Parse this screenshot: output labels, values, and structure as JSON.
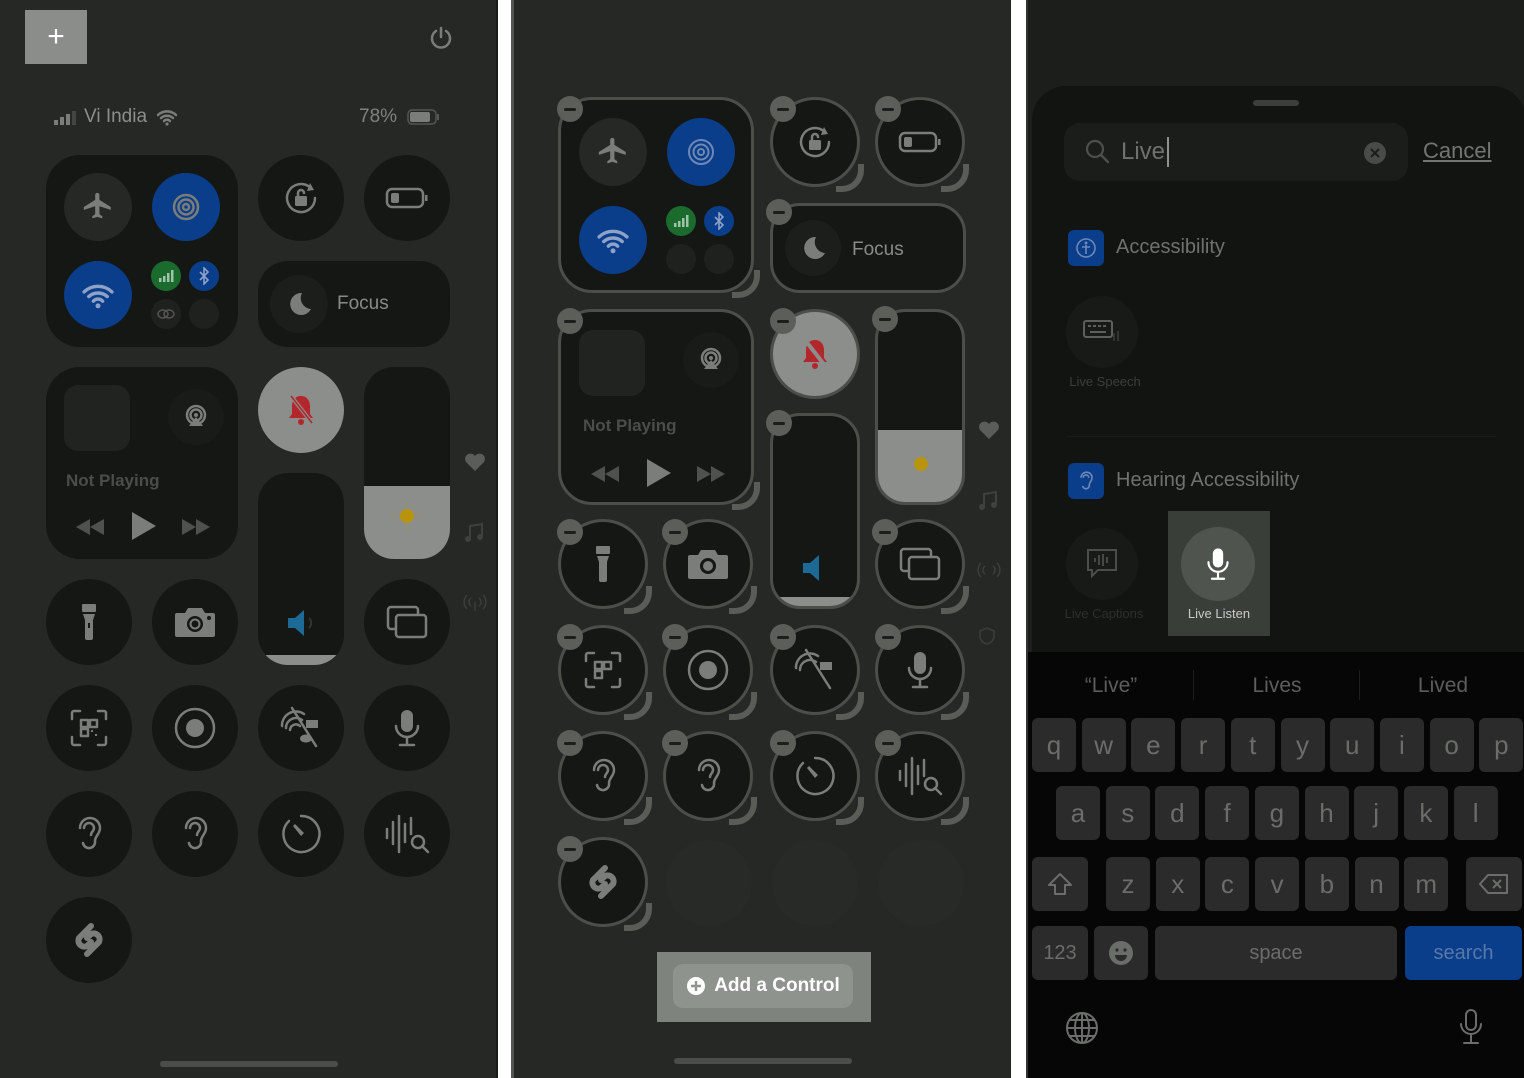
{
  "panel1": {
    "add_button_label": "+",
    "status_bar": {
      "carrier": "Vi India",
      "battery_percent": "78%"
    },
    "focus_label": "Focus",
    "media": {
      "status": "Not Playing"
    },
    "side_icons": [
      "heart-icon",
      "music-note-icon",
      "antenna-icon"
    ],
    "controls": [
      "airplane-mode",
      "airdrop",
      "wifi",
      "cellular",
      "bluetooth",
      "link",
      "vpn",
      "orientation-lock",
      "low-power-mode",
      "focus",
      "silent-mode",
      "brightness",
      "volume",
      "flashlight",
      "camera",
      "screen-mirroring",
      "code-scanner",
      "screen-recording",
      "hide-alert",
      "voice-memo",
      "hearing-1",
      "hearing-2",
      "timer",
      "music-recognition-search",
      "shazam"
    ],
    "brightness_level": 0.38,
    "volume_level": 0.05
  },
  "panel2": {
    "focus_label": "Focus",
    "media": {
      "status": "Not Playing"
    },
    "add_control_label": "Add a Control",
    "side_icons": [
      "heart-icon",
      "music-note-icon",
      "antenna-icon",
      "shield-icon"
    ]
  },
  "panel3": {
    "search": {
      "value": "Live",
      "cancel_label": "Cancel"
    },
    "sections": [
      {
        "title": "Accessibility",
        "items": [
          {
            "label": "Live Speech",
            "icon": "keyboard-speaker-icon"
          }
        ]
      },
      {
        "title": "Hearing Accessibility",
        "items": [
          {
            "label": "Live Captions",
            "icon": "captions-icon"
          },
          {
            "label": "Live Listen",
            "icon": "microphone-icon",
            "highlighted": true
          }
        ]
      }
    ],
    "keyboard": {
      "suggestions": [
        "“Live”",
        "Lives",
        "Lived"
      ],
      "row1": [
        "q",
        "w",
        "e",
        "r",
        "t",
        "y",
        "u",
        "i",
        "o",
        "p"
      ],
      "row2": [
        "a",
        "s",
        "d",
        "f",
        "g",
        "h",
        "j",
        "k",
        "l"
      ],
      "row3": [
        "z",
        "x",
        "c",
        "v",
        "b",
        "n",
        "m"
      ],
      "numbers_label": "123",
      "space_label": "space",
      "search_label": "search"
    }
  },
  "colors": {
    "accent_blue": "#0a3d8a",
    "cellular_green": "#1c6b2e",
    "silent_red": "#b3262b",
    "sun_yellow": "#b8940c",
    "volume_blue": "#1e6a96"
  }
}
